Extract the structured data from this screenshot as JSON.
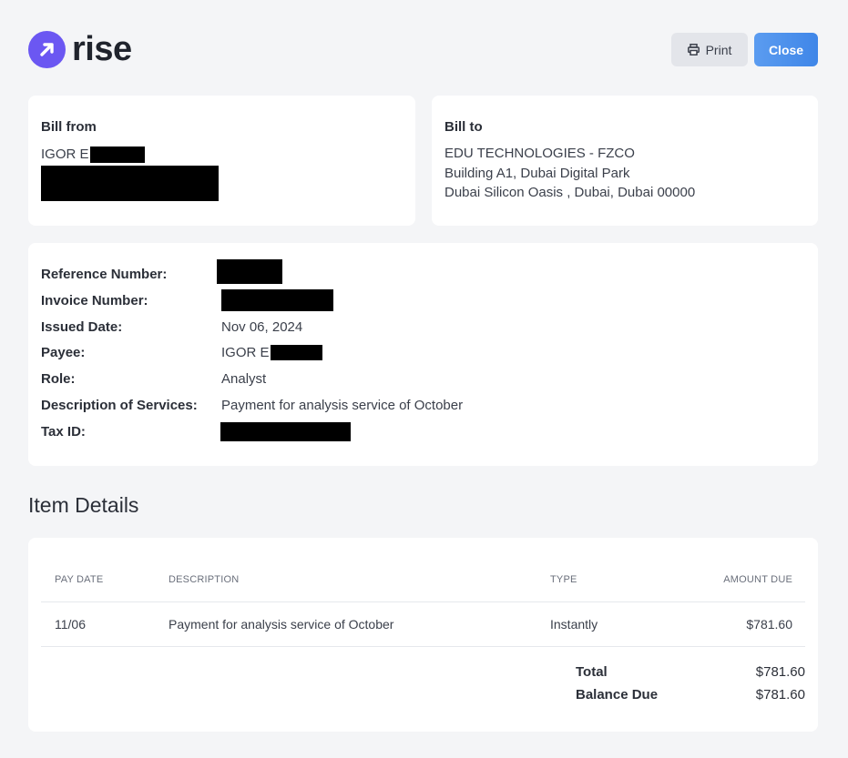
{
  "brand": {
    "name": "rise",
    "color": "#6b57f2"
  },
  "toolbar": {
    "print_label": "Print",
    "close_label": "Close",
    "print_icon": "printer-icon"
  },
  "bill_from": {
    "title": "Bill from",
    "name_prefix": "IGOR E"
  },
  "bill_to": {
    "title": "Bill to",
    "lines": [
      "EDU TECHNOLOGIES - FZCO",
      "Building A1, Dubai Digital Park",
      "Dubai Silicon Oasis , Dubai, Dubai 00000"
    ]
  },
  "info": {
    "reference_label": "Reference Number:",
    "invoice_label": "Invoice Number:",
    "issued_label": "Issued Date:",
    "issued_value": "Nov 06, 2024",
    "payee_label": "Payee:",
    "payee_prefix": "IGOR E",
    "role_label": "Role:",
    "role_value": "Analyst",
    "description_label": "Description of Services:",
    "description_value": "Payment for analysis service of October",
    "taxid_label": "Tax ID:"
  },
  "items": {
    "section_title": "Item Details",
    "columns": [
      "PAY DATE",
      "DESCRIPTION",
      "TYPE",
      "AMOUNT DUE"
    ],
    "rows": [
      {
        "pay_date": "11/06",
        "description": "Payment for analysis service of October",
        "type": "Instantly",
        "amount": "$781.60"
      }
    ],
    "total_label": "Total",
    "total_value": "$781.60",
    "balance_label": "Balance Due",
    "balance_value": "$781.60"
  }
}
